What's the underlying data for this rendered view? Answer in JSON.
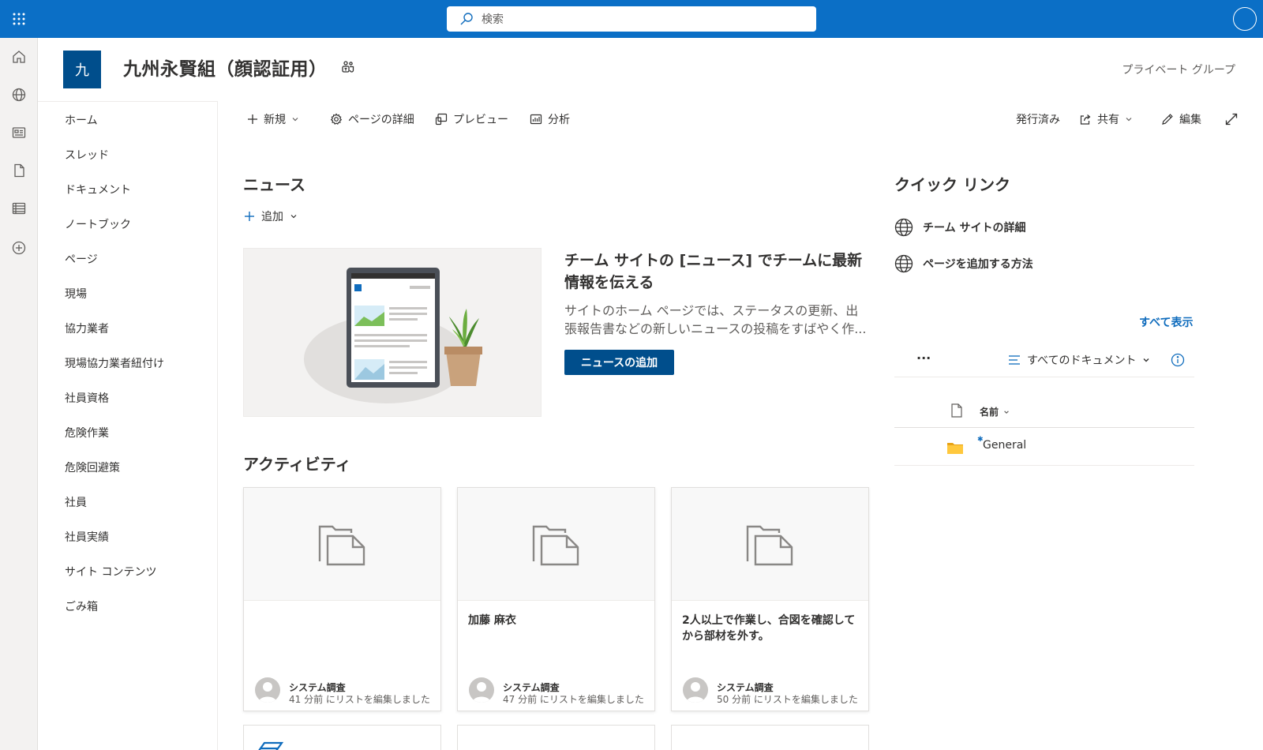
{
  "colors": {
    "suitebar": "#0b6fc6",
    "site_logo": "#004e8c",
    "primary_button": "#004e8c",
    "link": "#0f6cbd"
  },
  "search": {
    "placeholder": "検索"
  },
  "site": {
    "logo_letter": "九",
    "title": "九州永賢組（顔認証用）",
    "group_type": "プライベート グループ"
  },
  "appbar": {
    "items": [
      "home-icon",
      "globe-icon",
      "news-icon",
      "document-icon",
      "list-icon",
      "add-icon"
    ]
  },
  "nav": {
    "items": [
      "ホーム",
      "スレッド",
      "ドキュメント",
      "ノートブック",
      "ページ",
      "現場",
      "協力業者",
      "現場協力業者紐付け",
      "社員資格",
      "危険作業",
      "危険回避策",
      "社員",
      "社員実績",
      "サイト コンテンツ",
      "ごみ箱"
    ]
  },
  "commandbar": {
    "new": "新規",
    "page_details": "ページの詳細",
    "preview": "プレビュー",
    "analytics": "分析",
    "status": "発行済み",
    "share": "共有",
    "edit": "編集"
  },
  "news": {
    "title": "ニュース",
    "add": "追加",
    "headline": "チーム サイトの [ニュース] でチームに最新情報を伝える",
    "description": "サイトのホーム ページでは、ステータスの更新、出張報告書などの新しいニュースの投稿をすばやく作...",
    "button": "ニュースの追加"
  },
  "activity": {
    "title": "アクティビティ",
    "cards": [
      {
        "title": "",
        "author": "システム調査",
        "meta": "41 分前 にリストを編集しました"
      },
      {
        "title": "加藤 麻衣",
        "author": "システム調査",
        "meta": "47 分前 にリストを編集しました"
      },
      {
        "title": "2人以上で作業し、合図を確認してから部材を外す。",
        "author": "システム調査",
        "meta": "50 分前 にリストを編集しました"
      }
    ]
  },
  "quicklinks": {
    "title": "クイック リンク",
    "items": [
      "チーム サイトの詳細",
      "ページを追加する方法"
    ]
  },
  "doclib": {
    "see_all": "すべて表示",
    "more": "...",
    "view": "すべてのドキュメント",
    "column_name": "名前",
    "files": [
      {
        "name": "General",
        "type": "folder"
      }
    ]
  }
}
